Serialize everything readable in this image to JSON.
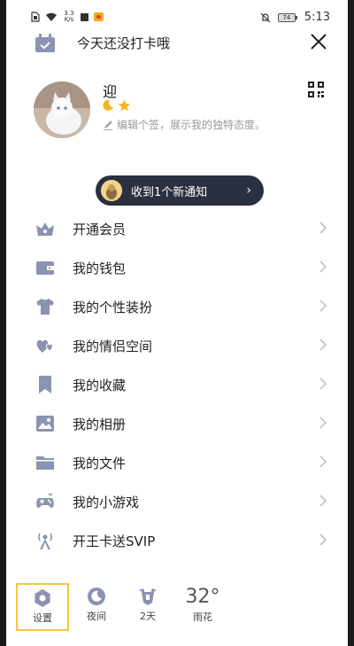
{
  "status_bar": {
    "net_speed_value": "3.3",
    "net_speed_unit": "K/s",
    "battery_level": "74",
    "time": "5:13"
  },
  "header": {
    "checkin_text": "今天还没打卡哦"
  },
  "profile": {
    "nickname": "迎",
    "signature_placeholder": "编辑个签，展示我的独特态度。"
  },
  "notification": {
    "text": "收到1个新通知"
  },
  "menu": {
    "items": [
      {
        "label": "开通会员",
        "icon": "vip-crown-icon"
      },
      {
        "label": "我的钱包",
        "icon": "wallet-icon"
      },
      {
        "label": "我的个性装扮",
        "icon": "tshirt-icon"
      },
      {
        "label": "我的情侣空间",
        "icon": "couple-hearts-icon"
      },
      {
        "label": "我的收藏",
        "icon": "bookmark-icon"
      },
      {
        "label": "我的相册",
        "icon": "photo-album-icon"
      },
      {
        "label": "我的文件",
        "icon": "folder-icon"
      },
      {
        "label": "我的小游戏",
        "icon": "gamepad-icon"
      },
      {
        "label": "开王卡送SVIP",
        "icon": "signal-tower-icon"
      }
    ]
  },
  "bottom_bar": {
    "settings_label": "设置",
    "night_label": "夜间",
    "checkin_days_label": "2天",
    "weather_temp": "32°",
    "weather_label": "雨花"
  },
  "colors": {
    "icon_color": "#8c93b0",
    "pill_background": "#2b3040",
    "highlight_border": "#f5c542"
  }
}
